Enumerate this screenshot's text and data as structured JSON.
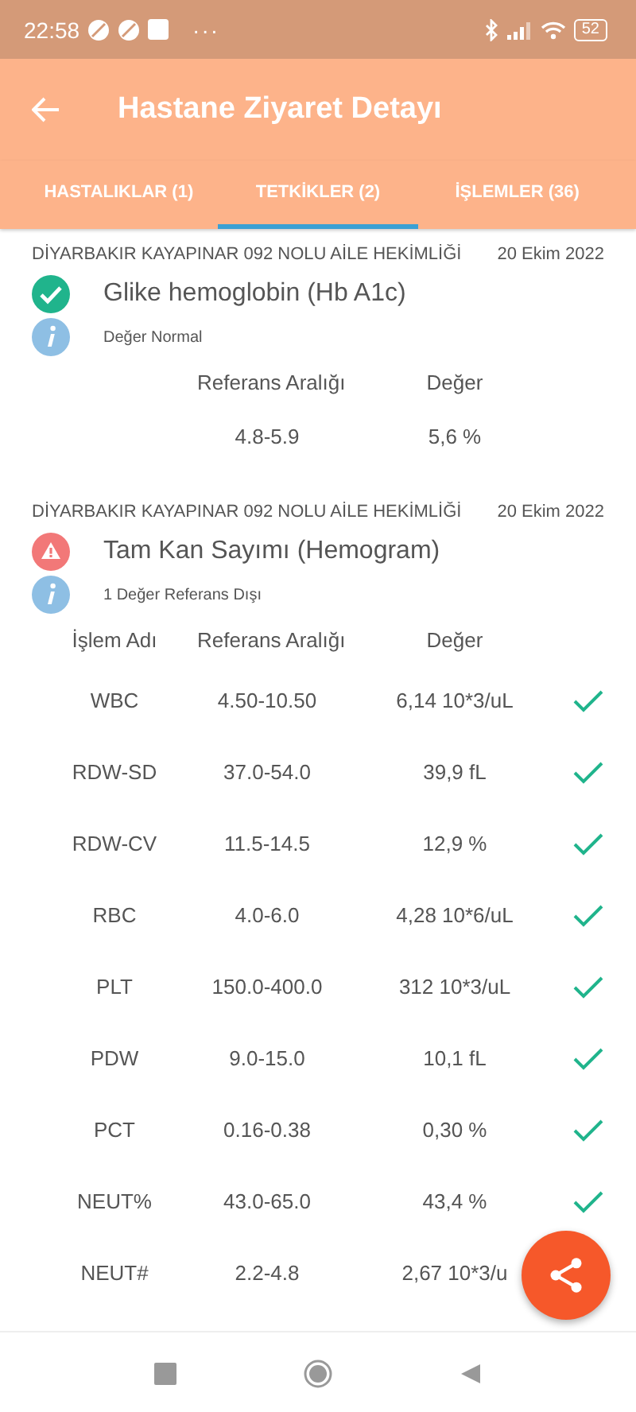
{
  "status_bar": {
    "time": "22:58",
    "more": "···",
    "battery": "52"
  },
  "app_bar": {
    "title": "Hastane Ziyaret Detayı"
  },
  "tabs": [
    {
      "label": "HASTALIKLAR (1)",
      "selected": false
    },
    {
      "label": "TETKİKLER (2)",
      "selected": true
    },
    {
      "label": "İŞLEMLER (36)",
      "selected": false
    }
  ],
  "tests": [
    {
      "institution": "DİYARBAKIR KAYAPINAR  092  NOLU AİLE HEKİMLİĞİ",
      "date": "20 Ekim 2022",
      "name": "Glike hemoglobin (Hb A1c)",
      "abnormal": false,
      "info": "Değer Normal",
      "columns": [
        "Referans Aralığı",
        "Değer"
      ],
      "rows": [
        {
          "range": "4.8-5.9",
          "value": "5,6 %"
        }
      ]
    },
    {
      "institution": "DİYARBAKIR KAYAPINAR  092  NOLU AİLE HEKİMLİĞİ",
      "date": "20 Ekim 2022",
      "name": "Tam Kan Sayımı (Hemogram)",
      "abnormal": true,
      "info": "1 Değer Referans Dışı",
      "columns": [
        "İşlem Adı",
        "Referans Aralığı",
        "Değer"
      ],
      "rows": [
        {
          "item": "WBC",
          "range": "4.50-10.50",
          "value": "6,14 10*3/uL",
          "in_range": true
        },
        {
          "item": "RDW-SD",
          "range": "37.0-54.0",
          "value": "39,9 fL",
          "in_range": true
        },
        {
          "item": "RDW-CV",
          "range": "11.5-14.5",
          "value": "12,9 %",
          "in_range": true
        },
        {
          "item": "RBC",
          "range": "4.0-6.0",
          "value": "4,28 10*6/uL",
          "in_range": true
        },
        {
          "item": "PLT",
          "range": "150.0-400.0",
          "value": "312 10*3/uL",
          "in_range": true
        },
        {
          "item": "PDW",
          "range": "9.0-15.0",
          "value": "10,1 fL",
          "in_range": true
        },
        {
          "item": "PCT",
          "range": "0.16-0.38",
          "value": "0,30 %",
          "in_range": true
        },
        {
          "item": "NEUT%",
          "range": "43.0-65.0",
          "value": "43,4 %",
          "in_range": true
        },
        {
          "item": "NEUT#",
          "range": "2.2-4.8",
          "value": "2,67 10*3/u"
        }
      ]
    }
  ]
}
